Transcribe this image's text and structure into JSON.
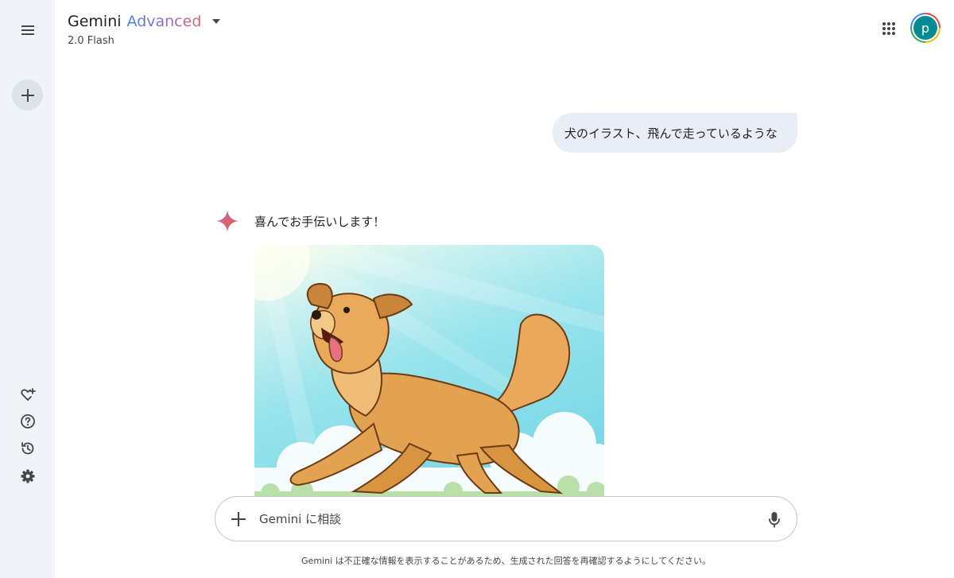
{
  "header": {
    "title": "Gemini",
    "tier": "Advanced",
    "model": "2.0 Flash"
  },
  "account": {
    "avatar_letter": "p",
    "avatar_color": "#078b93"
  },
  "sidebar": {
    "icons": [
      "menu-icon",
      "plus-icon",
      "gem-icon",
      "help-icon",
      "history-icon",
      "settings-icon"
    ],
    "background": "#f0f4f9"
  },
  "chat": {
    "user_message": "犬のイラスト、飛んで走っているような",
    "assistant_reply": "喜んでお手伝いします！",
    "assistant_image": "illustration of a golden retriever dog running and jumping under a blue sky"
  },
  "input": {
    "placeholder": "Gemini に相談"
  },
  "disclaimer": "Gemini は不正確な情報を表示することがあるため、生成された回答を再確認するようにしてください。",
  "colors": {
    "accent_gradient": [
      "#4a7ef0",
      "#8b6fd6",
      "#d96570"
    ],
    "user_bubble": "#e9eef6"
  }
}
